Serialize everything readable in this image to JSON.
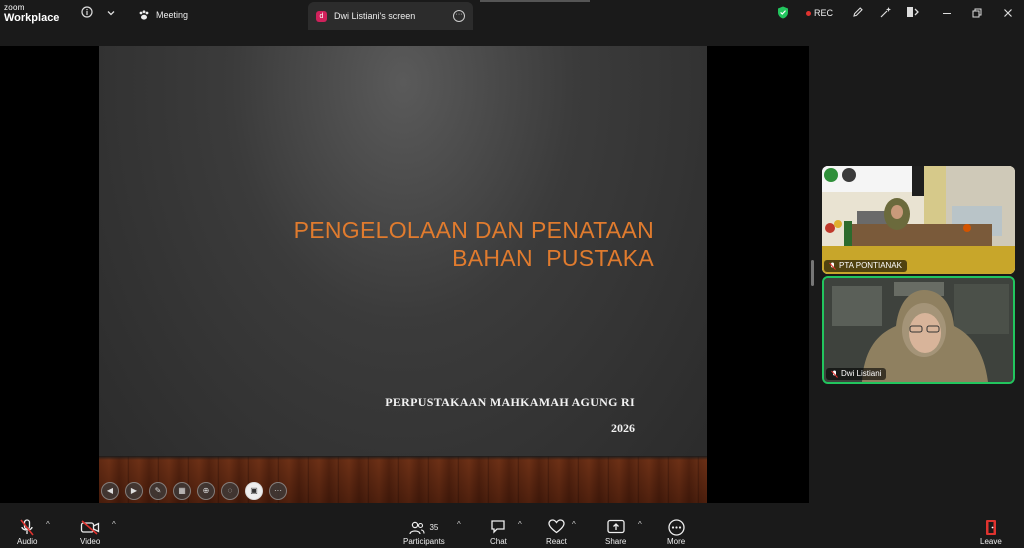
{
  "app": {
    "logo_line1": "zoom",
    "logo_line2": "Workplace"
  },
  "topbar": {
    "meeting_tab": "Meeting",
    "share_tab": "Dwi Listiani's screen",
    "share_badge": "d",
    "rec_label": "REC"
  },
  "slide": {
    "title_line1": "PENGELOLAAN DAN PENATAAN",
    "title_line2": "BAHAN  PUSTAKA",
    "organization": "PERPUSTAKAAN MAHKAMAH AGUNG RI",
    "year": "2026",
    "title_color": "#e07b2e"
  },
  "participants": [
    {
      "name": "PTA PONTIANAK"
    },
    {
      "name": "Dwi Listiani",
      "active_speaker": true
    }
  ],
  "toolbar": {
    "audio": "Audio",
    "video": "Video",
    "participants": "Participants",
    "participants_count": "35",
    "chat": "Chat",
    "react": "React",
    "share": "Share",
    "more": "More",
    "leave": "Leave"
  },
  "colors": {
    "accent_green": "#22c55e",
    "rec_red": "#e0332f",
    "leave_red": "#e0332f"
  }
}
